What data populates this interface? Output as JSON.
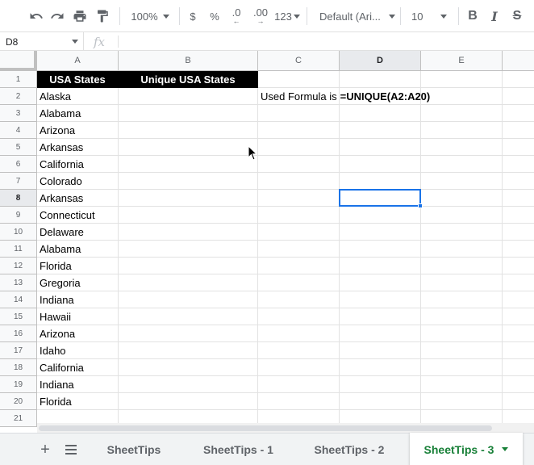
{
  "toolbar": {
    "zoom": "100%",
    "currency": "$",
    "percent": "%",
    "decrease_decimal": ".0",
    "increase_decimal": ".00",
    "number_format": "123",
    "font_family": "Default (Ari...",
    "font_size": "10",
    "bold": "B",
    "italic": "I",
    "strikethrough": "S"
  },
  "formula_bar": {
    "name_box": "D8",
    "fx": "fx"
  },
  "columns": [
    "A",
    "B",
    "C",
    "D",
    "E"
  ],
  "rows": [
    "1",
    "2",
    "3",
    "4",
    "5",
    "6",
    "7",
    "8",
    "9",
    "10",
    "11",
    "12",
    "13",
    "14",
    "15",
    "16",
    "17",
    "18",
    "19",
    "20",
    "21"
  ],
  "headers": {
    "col_a": "USA States",
    "col_b": "Unique USA States"
  },
  "states": [
    "Alaska",
    "Alabama",
    "Arizona",
    "Arkansas",
    "California",
    "Colorado",
    "Arkansas",
    "Connecticut",
    "Delaware",
    "Alabama",
    "Florida",
    "Gregoria",
    "Indiana",
    "Hawaii",
    "Arizona",
    "Idaho",
    "California",
    "Indiana",
    "Florida"
  ],
  "formula_note": {
    "label": "Used Formula is",
    "formula": "=UNIQUE(A2:A20)"
  },
  "selected_cell": "D8",
  "sheet_tabs": [
    "SheetTips",
    "SheetTips - 1",
    "SheetTips - 2",
    "SheetTips - 3"
  ],
  "active_tab": "SheetTips - 3",
  "icons": [
    "undo-icon",
    "redo-icon",
    "print-icon",
    "paint-format-icon",
    "add-sheet-icon",
    "all-sheets-icon",
    "dropdown-caret-icon",
    "mouse-cursor-icon"
  ],
  "colors": {
    "header_bg": "#000000",
    "header_text": "#ffffff",
    "selection": "#1a73e8",
    "active_tab": "#188038"
  }
}
